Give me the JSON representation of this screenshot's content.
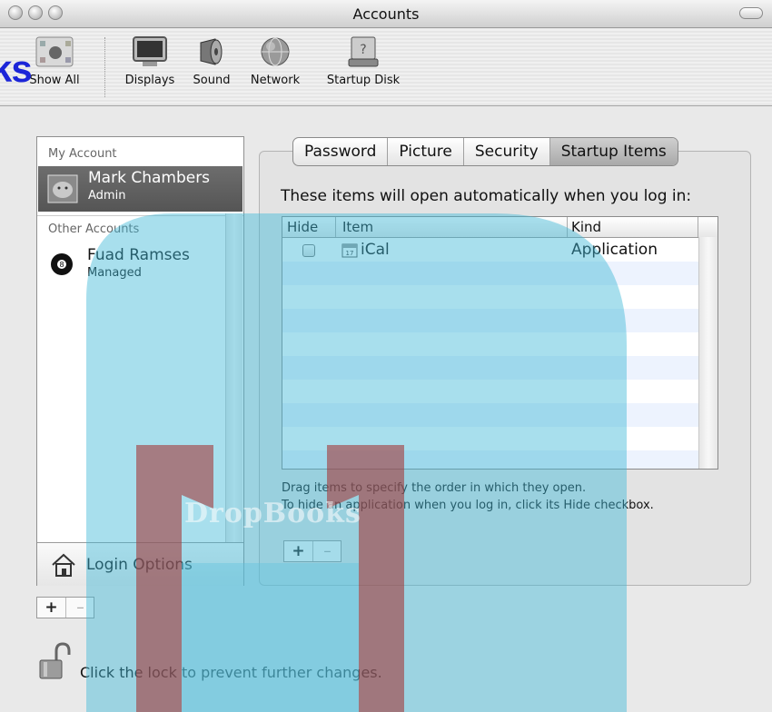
{
  "window": {
    "title": "Accounts"
  },
  "toolbar": {
    "items": [
      {
        "label": "Show All",
        "icon": "apple-grid-icon"
      },
      {
        "label": "Displays",
        "icon": "monitor-icon"
      },
      {
        "label": "Sound",
        "icon": "speaker-icon"
      },
      {
        "label": "Network",
        "icon": "globe-icon"
      },
      {
        "label": "Startup Disk",
        "icon": "disk-icon"
      }
    ]
  },
  "accounts": {
    "my_account_header": "My Account",
    "selected": {
      "name": "Mark Chambers",
      "role": "Admin"
    },
    "other_accounts_header": "Other Accounts",
    "others": [
      {
        "name": "Fuad Ramses",
        "role": "Managed"
      }
    ],
    "login_options": "Login Options",
    "add_label": "+",
    "remove_label": "–"
  },
  "tabs": [
    {
      "label": "Password",
      "active": false
    },
    {
      "label": "Picture",
      "active": false
    },
    {
      "label": "Security",
      "active": false
    },
    {
      "label": "Startup Items",
      "active": true
    }
  ],
  "startup": {
    "heading": "These items will open automatically when you log in:",
    "columns": {
      "hide": "Hide",
      "item": "Item",
      "kind": "Kind"
    },
    "rows": [
      {
        "hide": false,
        "item": "iCal",
        "kind": "Application"
      }
    ],
    "hint_line1": "Drag items to specify the order in which they open.",
    "hint_line2": "To hide an application when you log in, click its Hide checkbox.",
    "add_label": "+",
    "remove_label": "–"
  },
  "lock": {
    "text": "Click the lock to prevent further changes."
  },
  "watermark": {
    "corner_text": "ks",
    "brand": "DropBooks"
  },
  "colors": {
    "watermark_blue": "#1b25d8",
    "watermark_teal": "#3fb8d8",
    "watermark_maroon": "#a33a3a"
  }
}
